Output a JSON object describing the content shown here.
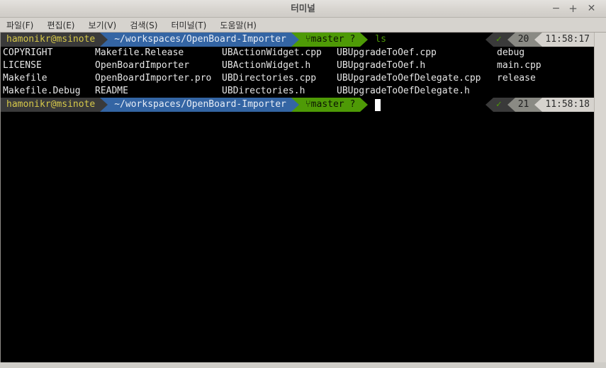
{
  "window": {
    "title": "터미널",
    "controls": {
      "minimize": "−",
      "maximize": "+",
      "close": "✕"
    }
  },
  "menubar": {
    "items": [
      {
        "label": "파일(F)"
      },
      {
        "label": "편집(E)"
      },
      {
        "label": "보기(V)"
      },
      {
        "label": "검색(S)"
      },
      {
        "label": "터미널(T)"
      },
      {
        "label": "도움말(H)"
      }
    ]
  },
  "terminal": {
    "prompt1": {
      "user": "hamonikr@msinote",
      "path": "~/workspaces/OpenBoard-Importer",
      "git": "⑂master ?",
      "command": "ls",
      "status_check": "✓",
      "status_count": "20",
      "status_time": "11:58:17"
    },
    "ls_output": {
      "rows": [
        {
          "c0": "COPYRIGHT",
          "c1": "Makefile.Release",
          "c2": "UBActionWidget.cpp",
          "c3": "UBUpgradeToOef.cpp",
          "c4": "debug"
        },
        {
          "c0": "LICENSE",
          "c1": "OpenBoardImporter",
          "c2": "UBActionWidget.h",
          "c3": "UBUpgradeToOef.h",
          "c4": "main.cpp"
        },
        {
          "c0": "Makefile",
          "c1": "OpenBoardImporter.pro",
          "c2": "UBDirectories.cpp",
          "c3": "UBUpgradeToOefDelegate.cpp",
          "c4": "release"
        },
        {
          "c0": "Makefile.Debug",
          "c1": "README",
          "c2": "UBDirectories.h",
          "c3": "UBUpgradeToOefDelegate.h",
          "c4": ""
        }
      ]
    },
    "prompt2": {
      "user": "hamonikr@msinote",
      "path": "~/workspaces/OpenBoard-Importer",
      "git": "⑂master ?",
      "command": "",
      "status_check": "✓",
      "status_count": "21",
      "status_time": "11:58:18"
    }
  },
  "colors": {
    "prompt_user_bg": "#3a3a3a",
    "prompt_user_fg": "#d7c94a",
    "prompt_path_bg": "#3465a4",
    "prompt_git_bg": "#4e9a06",
    "terminal_bg": "#000000",
    "terminal_fg": "#e6e6e6"
  }
}
